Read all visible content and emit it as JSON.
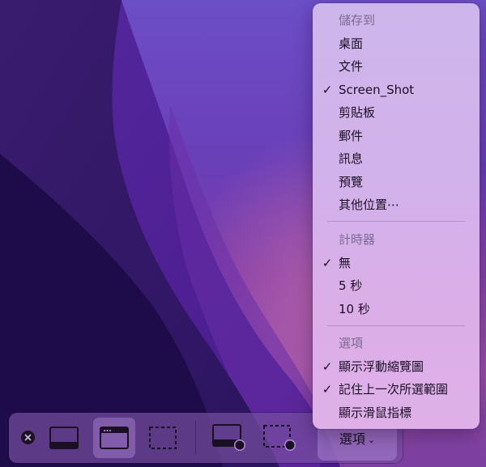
{
  "menu": {
    "save_to": {
      "header": "儲存到",
      "items": [
        {
          "label": "桌面",
          "checked": false
        },
        {
          "label": "文件",
          "checked": false
        },
        {
          "label": "Screen_Shot",
          "checked": true
        },
        {
          "label": "剪貼板",
          "checked": false
        },
        {
          "label": "郵件",
          "checked": false
        },
        {
          "label": "訊息",
          "checked": false
        },
        {
          "label": "預覽",
          "checked": false
        },
        {
          "label": "其他位置⋯",
          "checked": false
        }
      ]
    },
    "timer": {
      "header": "計時器",
      "items": [
        {
          "label": "無",
          "checked": true
        },
        {
          "label": "5 秒",
          "checked": false
        },
        {
          "label": "10 秒",
          "checked": false
        }
      ]
    },
    "options": {
      "header": "選項",
      "items": [
        {
          "label": "顯示浮動縮覽圖",
          "checked": true
        },
        {
          "label": "記住上一次所選範圍",
          "checked": true
        },
        {
          "label": "顯示滑鼠指標",
          "checked": false
        }
      ]
    },
    "checkmark": "✓"
  },
  "toolbar": {
    "options_label": "選項",
    "chevron": "⌄",
    "active_tool": "capture-window",
    "colors": {
      "accent": "#a078c8"
    }
  }
}
